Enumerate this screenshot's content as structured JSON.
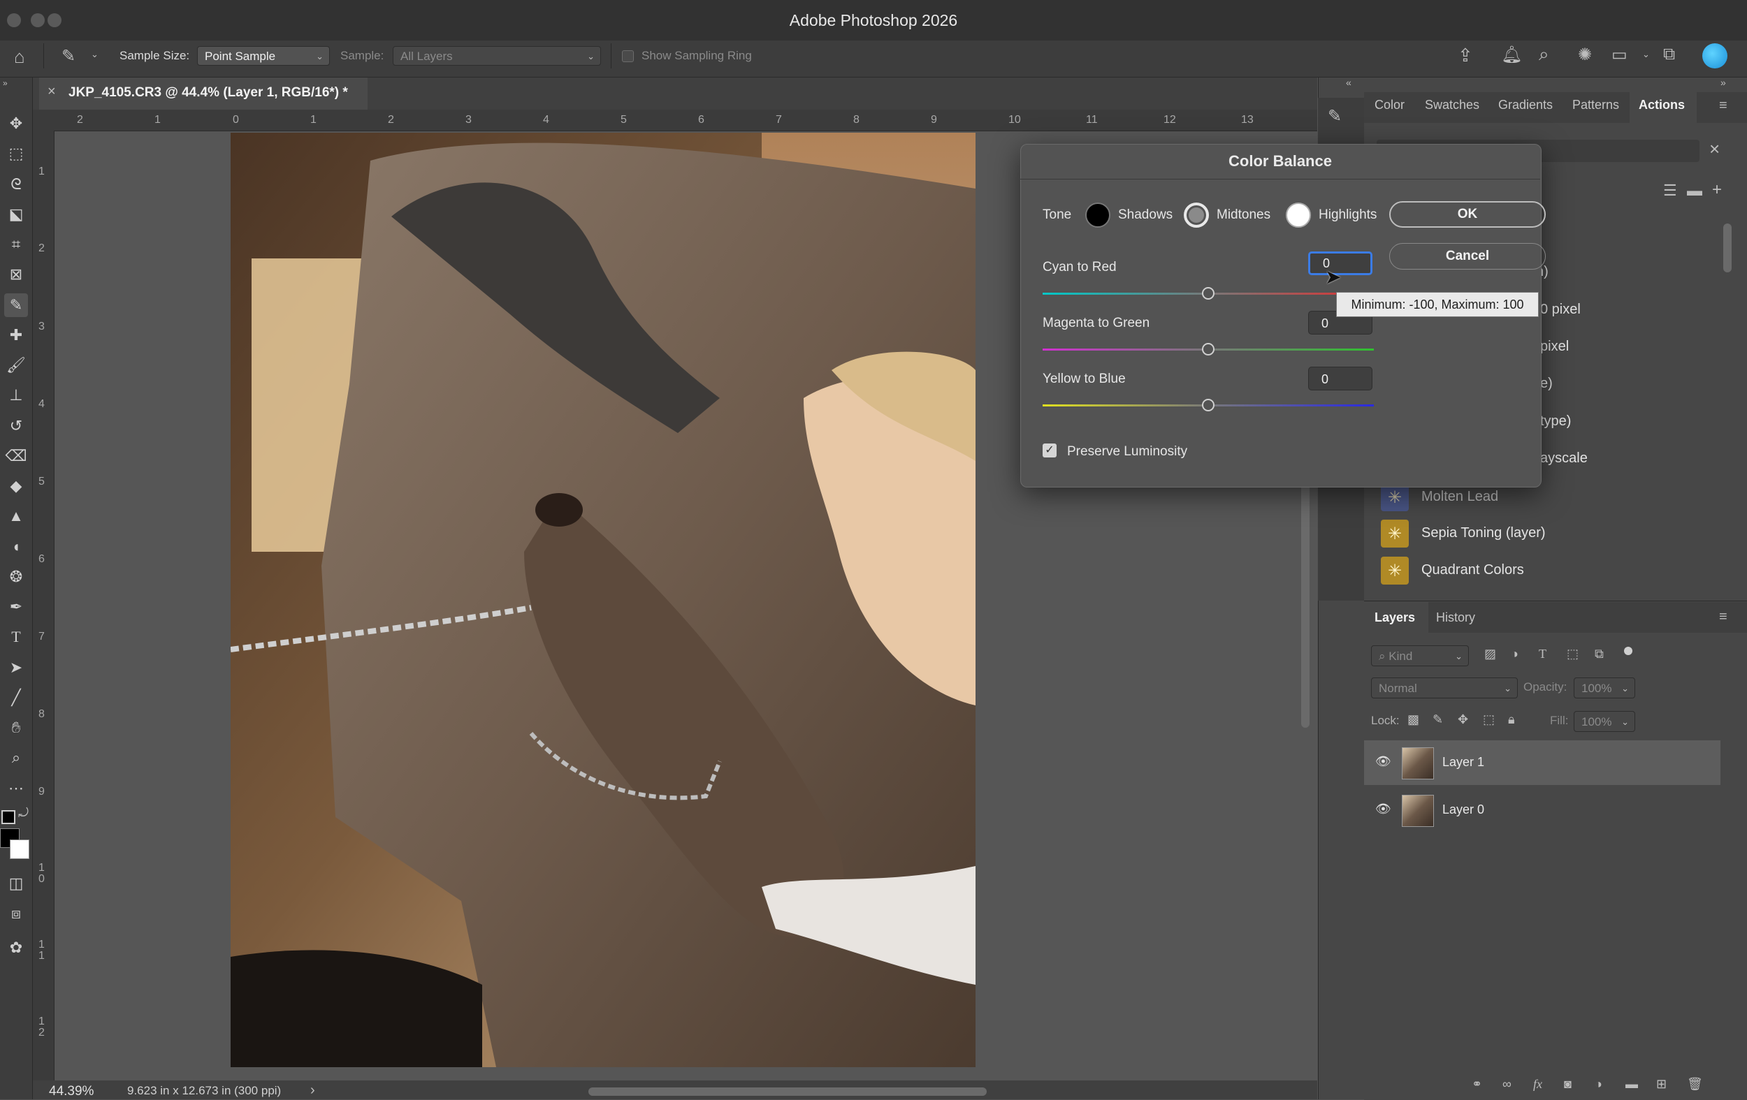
{
  "app": {
    "title": "Adobe Photoshop 2026"
  },
  "options_bar": {
    "sample_size_label": "Sample Size:",
    "sample_size_value": "Point Sample",
    "sample_label": "Sample:",
    "sample_value": "All Layers",
    "sampling_ring_label": "Show Sampling Ring"
  },
  "document": {
    "tab_title": "JKP_4105.CR3 @ 44.4% (Layer 1, RGB/16*) *",
    "ruler_top": [
      "2",
      "1",
      "0",
      "1",
      "2",
      "3",
      "4",
      "5",
      "6",
      "7",
      "8",
      "9",
      "10",
      "11",
      "12",
      "13"
    ],
    "ruler_left": [
      "1",
      "2",
      "3",
      "4",
      "5",
      "6",
      "7",
      "8",
      "9",
      "1 0",
      "1 1",
      "1 2"
    ]
  },
  "status_bar": {
    "zoom": "44.39%",
    "doc_info": "9.623 in x 12.673 in (300 ppi)",
    "arrow": "›"
  },
  "right_panel": {
    "tabs": [
      "Color",
      "Swatches",
      "Gradients",
      "Patterns",
      "Actions"
    ],
    "active_tab": "Actions",
    "partial_action_texts": [
      "n)",
      "0 pixel",
      "pixel",
      "e)",
      "type)",
      "ayscale"
    ],
    "actions": [
      {
        "label": "Molten Lead",
        "icon": "action-icon"
      },
      {
        "label": "Sepia Toning (layer)",
        "icon": "action-icon"
      },
      {
        "label": "Quadrant Colors",
        "icon": "action-icon"
      }
    ]
  },
  "layers_panel": {
    "tabs": [
      "Layers",
      "History"
    ],
    "filter_label": "Kind",
    "blend_mode": "Normal",
    "opacity_label": "Opacity:",
    "opacity_value": "100%",
    "lock_label": "Lock:",
    "fill_label": "Fill:",
    "fill_value": "100%",
    "layers": [
      {
        "name": "Layer 1",
        "selected": true
      },
      {
        "name": "Layer 0",
        "selected": false
      }
    ]
  },
  "dialog": {
    "title": "Color Balance",
    "tone_label": "Tone",
    "tones": [
      "Shadows",
      "Midtones",
      "Highlights"
    ],
    "selected_tone": "Midtones",
    "ok_label": "OK",
    "cancel_label": "Cancel",
    "sliders": [
      {
        "label": "Cyan to Red",
        "value": "0",
        "level": 0
      },
      {
        "label": "Magenta to Green",
        "value": "0",
        "level": 0
      },
      {
        "label": "Yellow to Blue",
        "value": "0",
        "level": 0
      }
    ],
    "preserve_luminosity_label": "Preserve Luminosity",
    "preserve_luminosity_checked": true,
    "tooltip": "Minimum: -100, Maximum: 100"
  },
  "colors": {
    "accent": "#3b7ce6",
    "action_icon": "#b08a26"
  }
}
